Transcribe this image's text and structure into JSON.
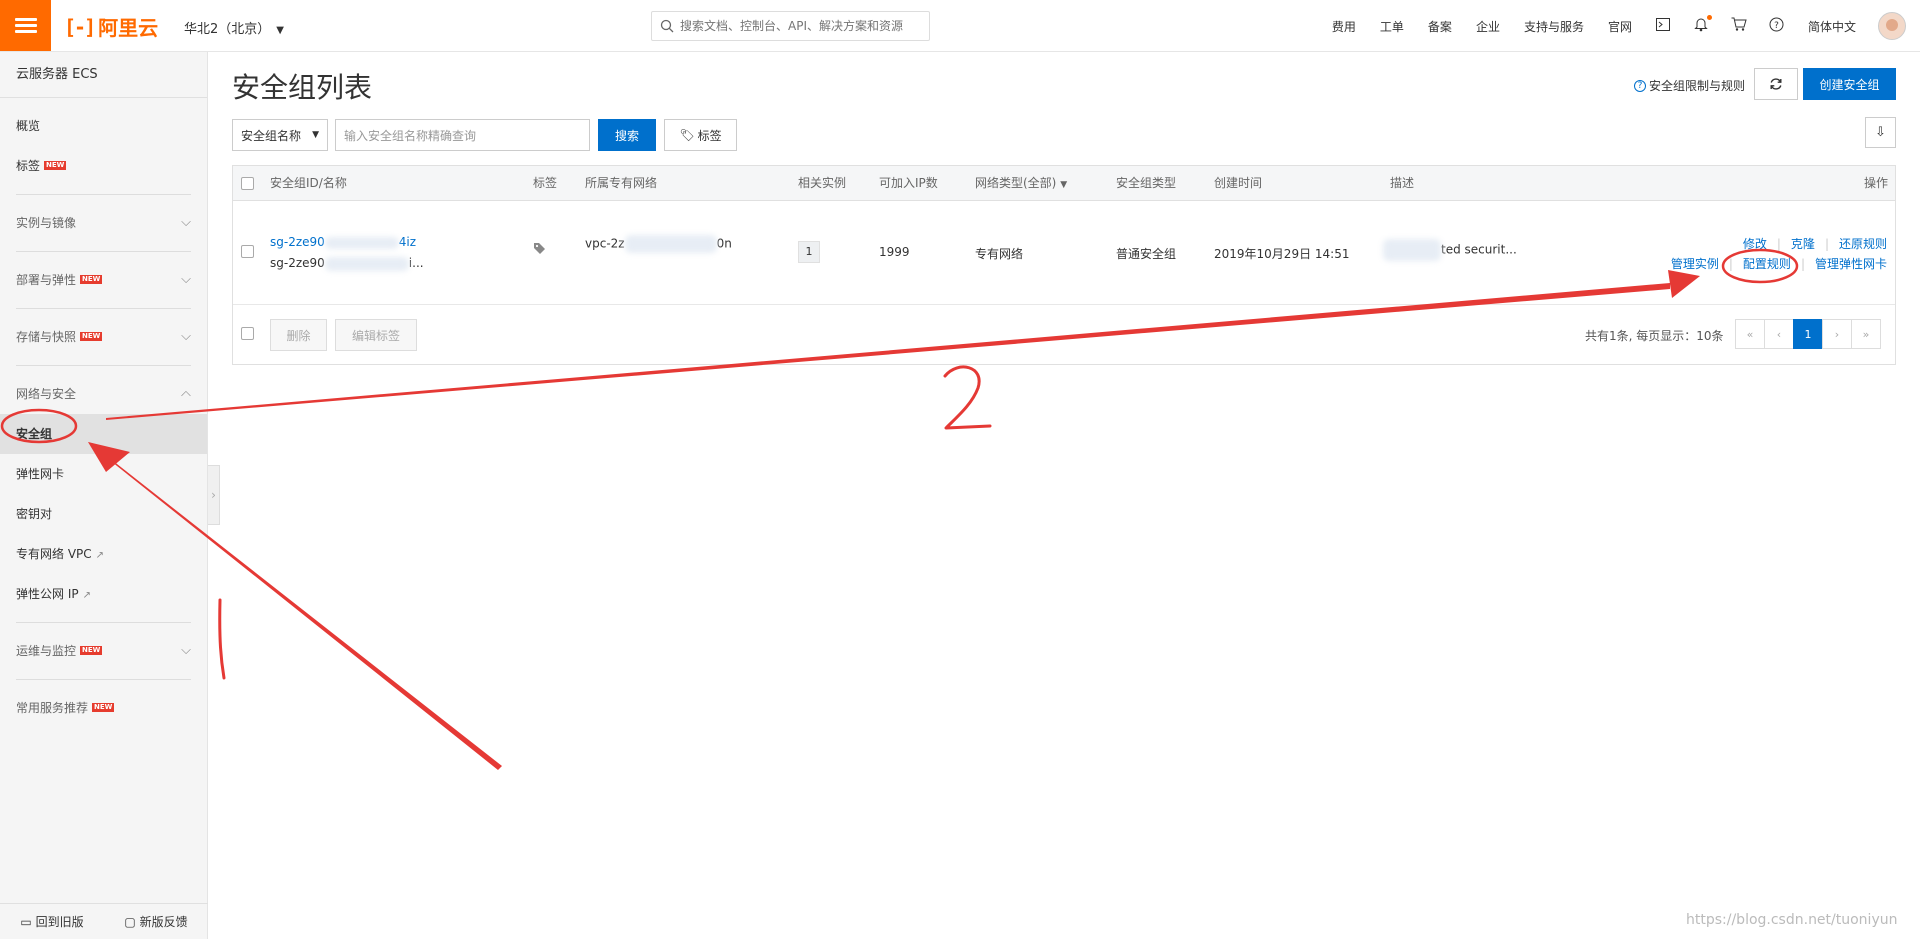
{
  "header": {
    "logo_text": "阿里云",
    "region": "华北2（北京）",
    "search_placeholder": "搜索文档、控制台、API、解决方案和资源",
    "links": [
      "费用",
      "工单",
      "备案",
      "企业",
      "支持与服务",
      "官网"
    ],
    "language": "简体中文"
  },
  "sidebar": {
    "title": "云服务器 ECS",
    "overview": "概览",
    "tags": "标签",
    "group_instances": "实例与镜像",
    "group_deploy": "部署与弹性",
    "group_storage": "存储与快照",
    "group_network": "网络与安全",
    "net_items": {
      "security_group": "安全组",
      "eni": "弹性网卡",
      "keypair": "密钥对",
      "vpc": "专有网络 VPC",
      "eip": "弹性公网 IP"
    },
    "group_ops": "运维与监控",
    "recommend": "常用服务推荐",
    "new_badge": "NEW",
    "bottom_back": "回到旧版",
    "bottom_feedback": "新版反馈"
  },
  "page": {
    "title": "安全组列表",
    "limits_link": "安全组限制与规则",
    "create_button": "创建安全组"
  },
  "filter": {
    "select_value": "安全组名称",
    "input_placeholder": "输入安全组名称精确查询",
    "search_button": "搜索",
    "tag_button": "标签"
  },
  "table": {
    "headers": {
      "id_name": "安全组ID/名称",
      "tag": "标签",
      "vpc": "所属专有网络",
      "instances": "相关实例",
      "ip_capacity": "可加入IP数",
      "network_type": "网络类型(全部)",
      "group_type": "安全组类型",
      "created": "创建时间",
      "desc": "描述",
      "ops": "操作"
    },
    "row": {
      "id_prefix": "sg-2ze90",
      "id_suffix": "4iz",
      "name_prefix": "sg-2ze90",
      "name_suffix": "i...",
      "vpc_prefix": "vpc-2z",
      "vpc_suffix": "0n",
      "instances": "1",
      "ip_capacity": "1999",
      "network_type": "专有网络",
      "group_type": "普通安全组",
      "created": "2019年10月29日 14:51",
      "desc_suffix": "ted securit...",
      "op_edit": "修改",
      "op_clone": "克隆",
      "op_restore": "还原规则",
      "op_manage_instances": "管理实例",
      "op_config_rules": "配置规则",
      "op_manage_eni": "管理弹性网卡"
    }
  },
  "footer": {
    "delete": "删除",
    "edit_tags": "编辑标签",
    "summary": "共有1条, 每页显示：10条",
    "pager": [
      "«",
      "‹",
      "1",
      "›",
      "»"
    ]
  },
  "annotations": {
    "label_1": "1",
    "label_2": "2"
  },
  "watermark": "https://blog.csdn.net/tuoniyun"
}
